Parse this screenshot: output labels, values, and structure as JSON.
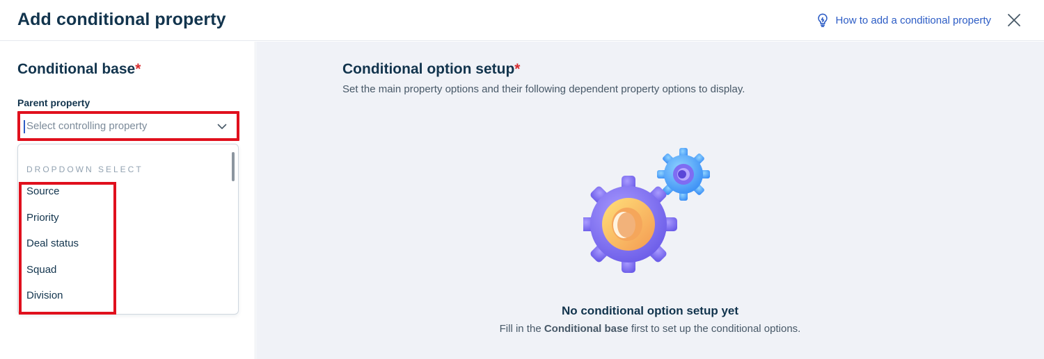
{
  "header": {
    "title": "Add conditional property",
    "help_link": "How to add a conditional property"
  },
  "left": {
    "section_title": "Conditional base",
    "required_mark": "*",
    "field_label": "Parent property",
    "select_placeholder": "Select controlling property",
    "dropdown": {
      "heading": "DROPDOWN SELECT",
      "options": [
        "Source",
        "Priority",
        "Deal status",
        "Squad",
        "Division"
      ]
    }
  },
  "right": {
    "title": "Conditional option setup",
    "required_mark": "*",
    "subtitle": "Set the main property options and their following dependent property options to display.",
    "empty_title": "No conditional option setup yet",
    "empty_desc_prefix": "Fill in the ",
    "empty_desc_bold": "Conditional base",
    "empty_desc_suffix": " first to set up the conditional options."
  },
  "colors": {
    "accent": "#2c5cc5",
    "required": "#d72d30",
    "highlight": "#e0101d",
    "text": "#12344d",
    "panel_bg": "#f0f2f7"
  },
  "icons": [
    "lightbulb-icon",
    "close-icon",
    "chevron-down-icon",
    "gears-illustration"
  ]
}
